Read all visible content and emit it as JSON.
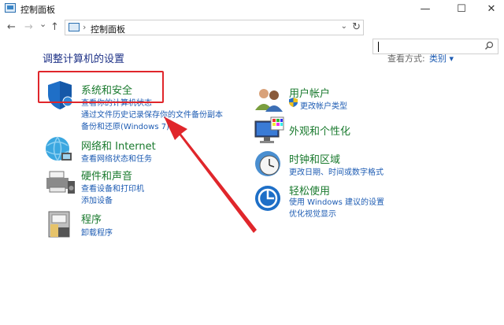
{
  "window": {
    "title": "控制面板",
    "min": "—",
    "max": "☐",
    "close": "✕"
  },
  "nav": {
    "back": "←",
    "forward": "→",
    "recent": "⌄",
    "up": "↑"
  },
  "address": {
    "separator": "›",
    "path": "控制面板",
    "dropdown": "⌄",
    "refresh": "↻"
  },
  "search": {
    "placeholder": "",
    "icon": "search-icon"
  },
  "heading": "调整计算机的设置",
  "view": {
    "label": "查看方式:",
    "value": "类别 ▾"
  },
  "left": [
    {
      "title": "系统和安全",
      "icon": "shield-icon",
      "links": [
        "查看你的计算机状态",
        "通过文件历史记录保存你的文件备份副本",
        "备份和还原(Windows 7)"
      ]
    },
    {
      "title": "网络和 Internet",
      "icon": "network-globe-icon",
      "links": [
        "查看网络状态和任务"
      ]
    },
    {
      "title": "硬件和声音",
      "icon": "printer-speaker-icon",
      "links": [
        "查看设备和打印机",
        "添加设备"
      ]
    },
    {
      "title": "程序",
      "icon": "programs-icon",
      "links": [
        "卸载程序"
      ]
    }
  ],
  "right": [
    {
      "title": "用户帐户",
      "icon": "users-icon",
      "links": [
        "更改帐户类型"
      ]
    },
    {
      "title": "外观和个性化",
      "icon": "monitor-palette-icon",
      "links": []
    },
    {
      "title": "时钟和区域",
      "icon": "clock-globe-icon",
      "links": [
        "更改日期、时间或数字格式"
      ]
    },
    {
      "title": "轻松使用",
      "icon": "ease-of-access-icon",
      "links": [
        "使用 Windows 建议的设置",
        "优化视觉显示"
      ]
    }
  ],
  "colors": {
    "link": "#1e5cb3",
    "category": "#1a7a2e",
    "heading": "#1e3287",
    "annotation": "#e0262b"
  }
}
